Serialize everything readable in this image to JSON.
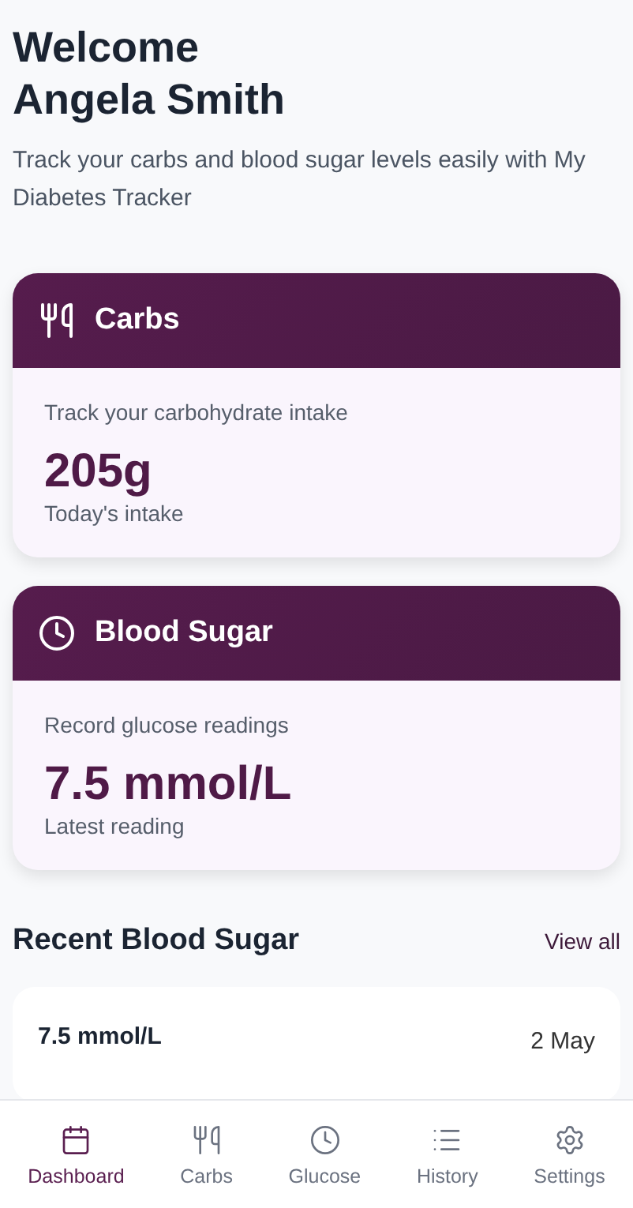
{
  "greeting": {
    "title_line_1": "Welcome",
    "title_line_2": "Angela Smith",
    "subtitle": "Track your carbs and blood sugar levels easily with My Diabetes Tracker"
  },
  "cards": [
    {
      "kind": "carbs",
      "title": "Carbs",
      "description": "Track your carbohydrate intake",
      "value": "205g",
      "caption": "Today's intake"
    },
    {
      "kind": "glucose",
      "title": "Blood Sugar",
      "description": "Record glucose readings",
      "value": "7.5 mmol/L",
      "caption": "Latest reading"
    }
  ],
  "recent": {
    "title": "Recent Blood Sugar",
    "link": "View all",
    "readings": [
      {
        "value": "7.5 mmol/L",
        "date": "2 May"
      }
    ]
  },
  "nav": [
    {
      "kind": "dashboard",
      "label": "Dashboard",
      "selected": true
    },
    {
      "kind": "carbs",
      "label": "Carbs",
      "selected": false
    },
    {
      "kind": "glucose",
      "label": "Glucose",
      "selected": false
    },
    {
      "kind": "history",
      "label": "History",
      "selected": false
    },
    {
      "kind": "settings",
      "label": "Settings",
      "selected": false
    }
  ]
}
